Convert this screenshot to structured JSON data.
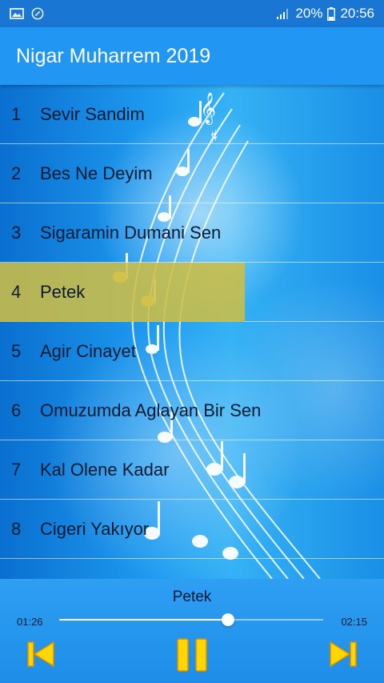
{
  "status_bar": {
    "battery": "20%",
    "time": "20:56",
    "icons": [
      "image-icon",
      "app-icon",
      "signal-icon",
      "battery-icon"
    ]
  },
  "app": {
    "title": "Nigar Muharrem 2019"
  },
  "playlist": [
    {
      "num": "1",
      "title": "Sevir Sandim"
    },
    {
      "num": "2",
      "title": "Bes Ne Deyim"
    },
    {
      "num": "3",
      "title": "Sigaramin Dumani Sen"
    },
    {
      "num": "4",
      "title": "Petek"
    },
    {
      "num": "5",
      "title": "Agir Cinayet"
    },
    {
      "num": "6",
      "title": "Omuzumda Aglayan Bir Sen"
    },
    {
      "num": "7",
      "title": "Kal Olene Kadar"
    },
    {
      "num": "8",
      "title": "Cigeri Yakıyor"
    }
  ],
  "selected_index": 4,
  "player": {
    "now_playing": "Petek",
    "elapsed": "01:26",
    "duration": "02:15",
    "progress": 0.64,
    "controls": [
      "previous-icon",
      "pause-icon",
      "next-icon"
    ],
    "control_color": "#ffd600"
  },
  "colors": {
    "status_bar": "#1976d2",
    "app_bar": "#2196f3",
    "highlight": "#cdbe46"
  }
}
